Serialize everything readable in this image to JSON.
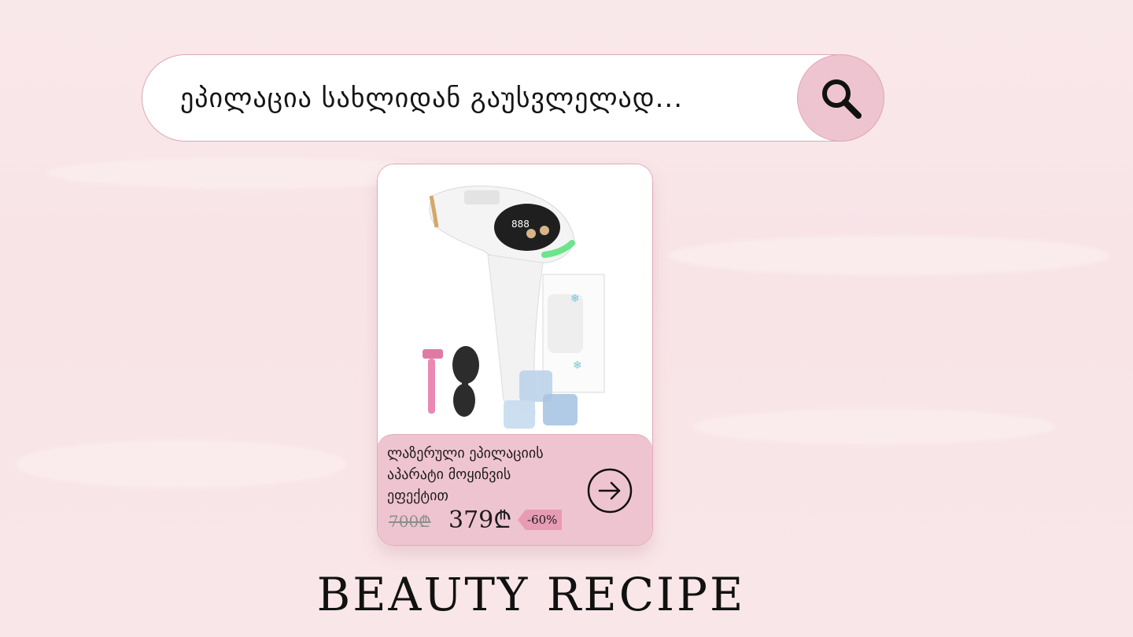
{
  "search": {
    "text": "ეპილაცია სახლიდან გაუსვლელად...",
    "icon": "magnifier-icon"
  },
  "product": {
    "title": "ლაზერული ეპილაციის აპარატი მოყინვის ეფექტით",
    "old_price": "700₾",
    "new_price": "379₾",
    "discount": "-60%",
    "image": "ipl-hair-removal-device-with-razor-and-goggles"
  },
  "brand": "BEAUTY RECIPE",
  "colors": {
    "accent_pink": "#efc4d1",
    "discount_pink": "#e89bb4",
    "border": "#dca9b5"
  }
}
